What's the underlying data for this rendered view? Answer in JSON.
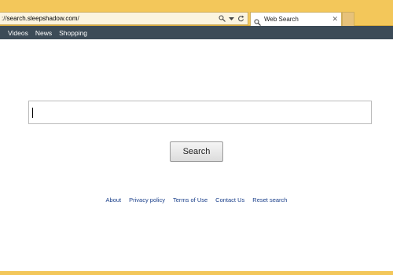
{
  "browser": {
    "address_prefix": "://",
    "address_domain": "search.sleepshadow.com",
    "address_suffix": "/",
    "tab_title": "Web Search",
    "tab_close": "✕"
  },
  "nav": {
    "items": [
      {
        "label": "Videos"
      },
      {
        "label": "News"
      },
      {
        "label": "Shopping"
      }
    ]
  },
  "search": {
    "input_value": "",
    "button_label": "Search"
  },
  "footer": {
    "links": [
      {
        "label": "About"
      },
      {
        "label": "Privacy policy"
      },
      {
        "label": "Terms of Use"
      },
      {
        "label": "Contact Us"
      },
      {
        "label": "Reset search"
      }
    ]
  },
  "colors": {
    "chrome": "#f3c75a",
    "navbar": "#3c4b57",
    "link": "#1a3f8a"
  }
}
